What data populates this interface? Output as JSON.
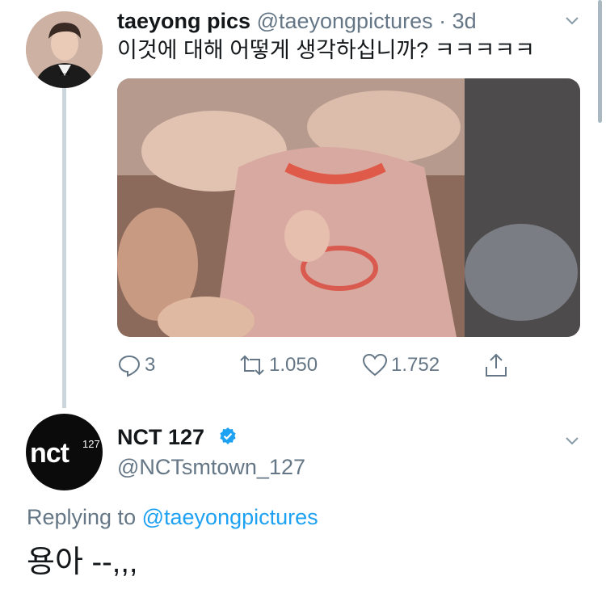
{
  "tweet1": {
    "author_name": "taeyong pics",
    "handle": "@taeyongpictures",
    "separator": "·",
    "time": "3d",
    "text": "이것에 대해 어떻게 생각하십니까? ㅋㅋㅋㅋㅋ",
    "actions": {
      "reply_count": "3",
      "retweet_count": "1.050",
      "like_count": "1.752"
    }
  },
  "tweet2": {
    "author_name": "NCT 127",
    "verified": true,
    "handle": "@NCTsmtown_127",
    "avatar_logo": "nct",
    "avatar_logo_sup": "127",
    "replying_prefix": "Replying to",
    "replying_handle": "@taeyongpictures",
    "text": "용아 --,,,"
  },
  "colors": {
    "accent": "#1da1f2",
    "muted": "#657786",
    "thread_line": "#ccd6dd",
    "text": "#14171a"
  },
  "icons": [
    "chevron-down-icon",
    "reply-icon",
    "retweet-icon",
    "like-icon",
    "share-icon",
    "verified-badge-icon"
  ]
}
